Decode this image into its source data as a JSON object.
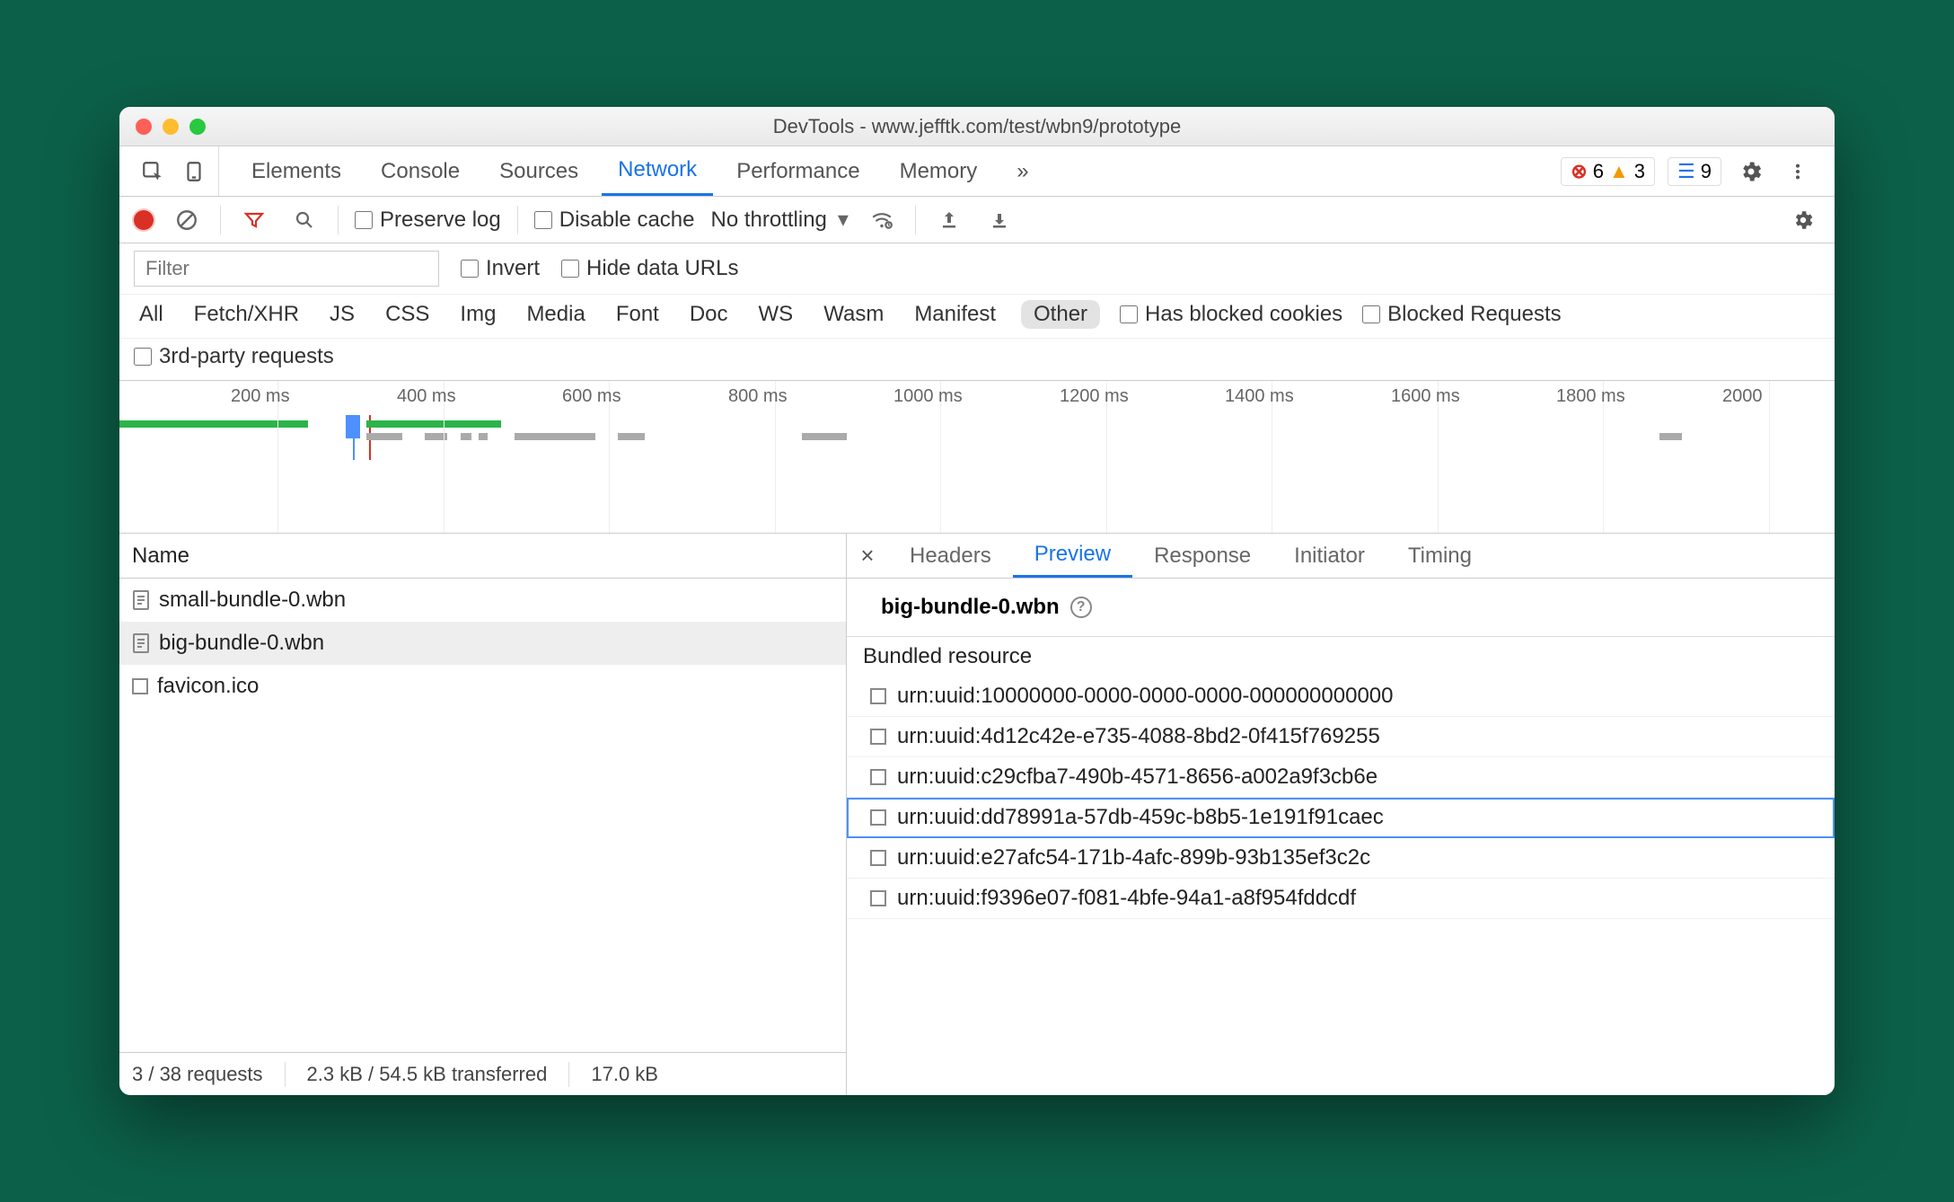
{
  "window": {
    "title": "DevTools - www.jefftk.com/test/wbn9/prototype"
  },
  "panels": {
    "items": [
      "Elements",
      "Console",
      "Sources",
      "Network",
      "Performance",
      "Memory"
    ],
    "active": "Network",
    "overflow": "»",
    "errors": "6",
    "warnings": "3",
    "messages": "9"
  },
  "toolbar": {
    "preserve_log": "Preserve log",
    "disable_cache": "Disable cache",
    "throttling": "No throttling"
  },
  "filter": {
    "placeholder": "Filter",
    "invert": "Invert",
    "hide_data_urls": "Hide data URLs",
    "types": [
      "All",
      "Fetch/XHR",
      "JS",
      "CSS",
      "Img",
      "Media",
      "Font",
      "Doc",
      "WS",
      "Wasm",
      "Manifest",
      "Other"
    ],
    "types_active": "Other",
    "has_blocked_cookies": "Has blocked cookies",
    "blocked_requests": "Blocked Requests",
    "third_party": "3rd-party requests"
  },
  "timeline": {
    "ticks": [
      "200 ms",
      "400 ms",
      "600 ms",
      "800 ms",
      "1000 ms",
      "1200 ms",
      "1400 ms",
      "1600 ms",
      "1800 ms",
      "2000"
    ]
  },
  "requests": {
    "header": "Name",
    "rows": [
      {
        "name": "small-bundle-0.wbn"
      },
      {
        "name": "big-bundle-0.wbn",
        "selected": true
      },
      {
        "name": "favicon.ico",
        "plainicon": true
      }
    ],
    "status": {
      "count": "3 / 38 requests",
      "transferred": "2.3 kB / 54.5 kB transferred",
      "resources": "17.0 kB "
    }
  },
  "detail": {
    "tabs": [
      "Headers",
      "Preview",
      "Response",
      "Initiator",
      "Timing"
    ],
    "active": "Preview",
    "preview_title": "big-bundle-0.wbn",
    "section": "Bundled resource",
    "resources": [
      "urn:uuid:10000000-0000-0000-0000-000000000000",
      "urn:uuid:4d12c42e-e735-4088-8bd2-0f415f769255",
      "urn:uuid:c29cfba7-490b-4571-8656-a002a9f3cb6e",
      "urn:uuid:dd78991a-57db-459c-b8b5-1e191f91caec",
      "urn:uuid:e27afc54-171b-4afc-899b-93b135ef3c2c",
      "urn:uuid:f9396e07-f081-4bfe-94a1-a8f954fddcdf"
    ],
    "selected_resource_index": 3
  }
}
